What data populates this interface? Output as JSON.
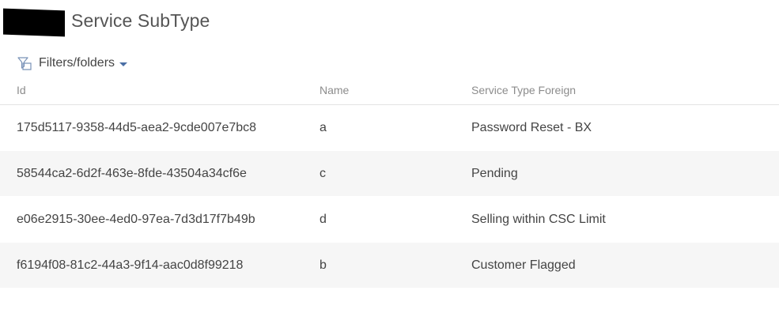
{
  "header": {
    "title": "Service SubType"
  },
  "toolbar": {
    "filters_label": "Filters/folders",
    "filters_icon": "filter-folder-icon"
  },
  "grid": {
    "columns": [
      "Id",
      "Name",
      "Service Type Foreign"
    ],
    "rows": [
      {
        "id": "175d5117-9358-44d5-aea2-9cde007e7bc8",
        "name": "a",
        "service_type": "Password Reset - BX"
      },
      {
        "id": "58544ca2-6d2f-463e-8fde-43504a34cf6e",
        "name": "c",
        "service_type": "Pending"
      },
      {
        "id": "e06e2915-30ee-4ed0-97ea-7d3d17f7b49b",
        "name": "d",
        "service_type": "Selling within CSC Limit"
      },
      {
        "id": "f6194f08-81c2-44a3-9f14-aac0d8f99218",
        "name": "b",
        "service_type": "Customer Flagged"
      }
    ]
  },
  "colors": {
    "accent": "#4a6fa5",
    "header_text": "#8c8c8c",
    "row_alt": "#f6f6f6"
  }
}
